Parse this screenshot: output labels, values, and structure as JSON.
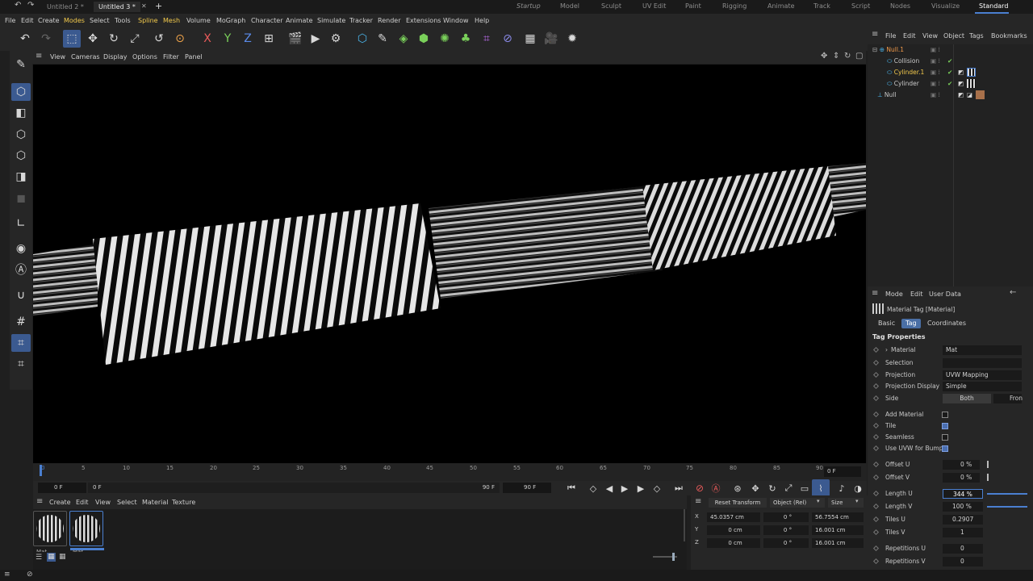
{
  "titlebar": {
    "tabs": [
      "Untitled 2 *",
      "Untitled 3 *"
    ],
    "new_tab": "+",
    "layouts": [
      "Startup",
      "Model",
      "Sculpt",
      "UV Edit",
      "Paint",
      "Rigging",
      "Animate",
      "Track",
      "Script",
      "Nodes",
      "Visualize",
      "Standard"
    ]
  },
  "menubar": [
    "File",
    "Edit",
    "Create",
    "Modes",
    "Select",
    "Tools",
    "Spline",
    "Mesh",
    "Volume",
    "MoGraph",
    "Character",
    "Animate",
    "Simulate",
    "Tracker",
    "Render",
    "Extensions",
    "Window",
    "Help"
  ],
  "viewport_menu": [
    "View",
    "Cameras",
    "Display",
    "Options",
    "Filter",
    "Panel"
  ],
  "timeline": {
    "ticks": [
      "0",
      "5",
      "10",
      "15",
      "20",
      "25",
      "30",
      "35",
      "40",
      "45",
      "50",
      "55",
      "60",
      "65",
      "70",
      "75",
      "80",
      "85",
      "90"
    ],
    "current": "0 F",
    "start": "0 F",
    "preview_start": "0 F",
    "preview_end": "90 F",
    "end": "90 F"
  },
  "material_manager": {
    "menu": [
      "Create",
      "Edit",
      "View",
      "Select",
      "Material",
      "Texture"
    ],
    "swatches": [
      "Mat",
      "Mat"
    ]
  },
  "coordinates": {
    "buttons": [
      "Reset Transform",
      "Object (Rel)",
      "Size"
    ],
    "rows": [
      {
        "axis": "X",
        "pos": "45.0357 cm",
        "rot": "0 °",
        "size": "56.7554 cm"
      },
      {
        "axis": "Y",
        "pos": "0 cm",
        "rot": "0 °",
        "size": "16.001 cm"
      },
      {
        "axis": "Z",
        "pos": "0 cm",
        "rot": "0 °",
        "size": "16.001 cm"
      }
    ]
  },
  "object_manager": {
    "menu": [
      "File",
      "Edit",
      "View",
      "Object",
      "Tags",
      "Bookmarks"
    ],
    "objects": [
      "Null.1",
      "Collision",
      "Cylinder.1",
      "Cylinder",
      "Null"
    ]
  },
  "attributes": {
    "menu": [
      "Mode",
      "Edit",
      "User Data"
    ],
    "header": "Material Tag [Material]",
    "tabs": [
      "Basic",
      "Tag",
      "Coordinates"
    ],
    "section": "Tag Properties",
    "material": {
      "label": "Material",
      "value": "Mat"
    },
    "selection": {
      "label": "Selection",
      "value": ""
    },
    "projection": {
      "label": "Projection",
      "value": "UVW Mapping"
    },
    "projection_display": {
      "label": "Projection Display",
      "value": "Simple"
    },
    "side": {
      "label": "Side",
      "options": [
        "Both",
        "Fron"
      ]
    },
    "add_material": {
      "label": "Add Material",
      "checked": false
    },
    "tile": {
      "label": "Tile",
      "checked": true
    },
    "seamless": {
      "label": "Seamless",
      "checked": false
    },
    "use_uvw": {
      "label": "Use UVW for Bump",
      "checked": true
    },
    "offset_u": {
      "label": "Offset U",
      "value": "0 %"
    },
    "offset_v": {
      "label": "Offset V",
      "value": "0 %"
    },
    "length_u": {
      "label": "Length U",
      "value": "344 %"
    },
    "length_v": {
      "label": "Length V",
      "value": "100 %"
    },
    "tiles_u": {
      "label": "Tiles U",
      "value": "0.2907"
    },
    "tiles_v": {
      "label": "Tiles V",
      "value": "1"
    },
    "rep_u": {
      "label": "Repetitions U",
      "value": "0"
    },
    "rep_v": {
      "label": "Repetitions V",
      "value": "0"
    }
  }
}
